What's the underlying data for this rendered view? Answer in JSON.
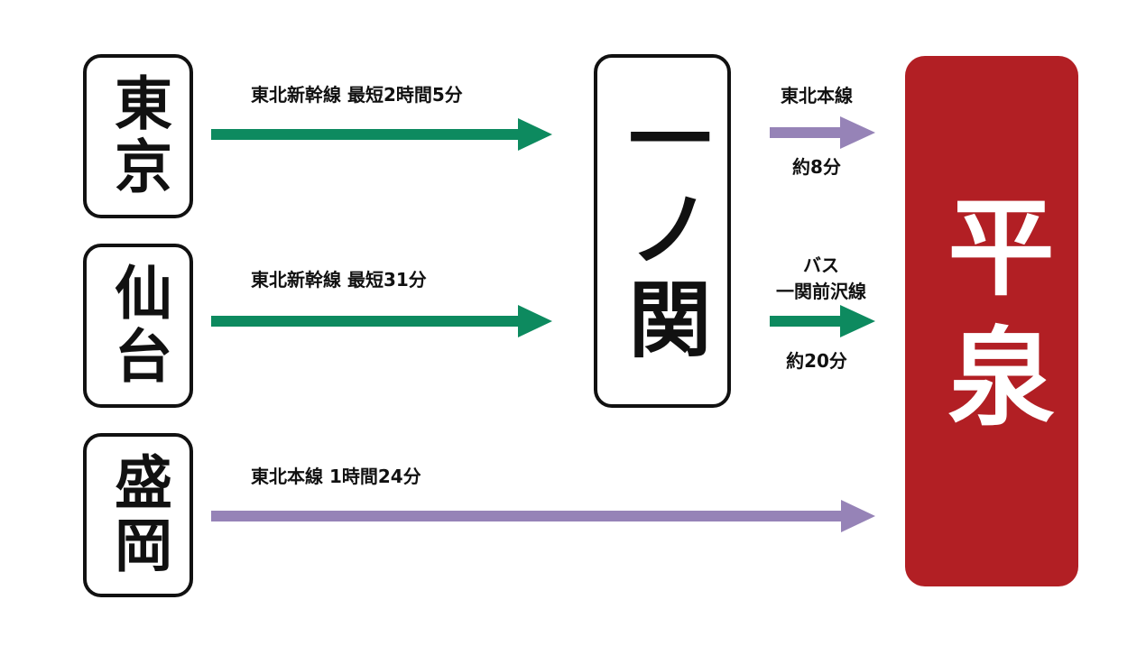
{
  "colors": {
    "shinkansen_arrow": "#0d8a5f",
    "local_arrow": "#9683b7",
    "destination_bg": "#b21f24",
    "station_border": "#111111"
  },
  "origins": {
    "tokyo": "東京",
    "sendai": "仙台",
    "morioka": "盛岡"
  },
  "transfer": {
    "ichinoseki": "一ノ関"
  },
  "destination": {
    "hiraizumi": "平泉"
  },
  "routes": {
    "tokyo": {
      "label": "東北新幹線 最短2時間5分"
    },
    "sendai": {
      "label": "東北新幹線 最短31分"
    },
    "morioka": {
      "label": "東北本線 1時間24分"
    },
    "ichinoseki_train": {
      "line": "東北本線",
      "time": "約8分"
    },
    "ichinoseki_bus": {
      "mode": "バス",
      "line": "一関前沢線",
      "time": "約20分"
    }
  }
}
